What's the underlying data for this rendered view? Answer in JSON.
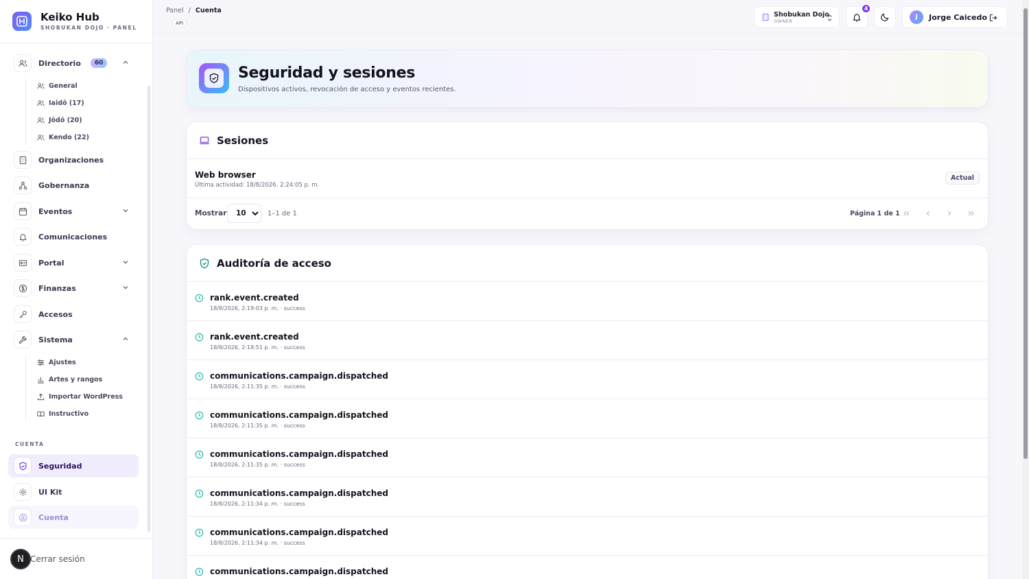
{
  "brand": {
    "title": "Keiko Hub",
    "subtitle": "SHOBUKAN DOJO · PANEL"
  },
  "sidebar": {
    "directorio": {
      "label": "Directorio",
      "badge": "60"
    },
    "directorio_items": [
      "General",
      "Iaidō (17)",
      "Jōdō (20)",
      "Kendo (22)"
    ],
    "items": {
      "organizaciones": "Organizaciones",
      "gobernanza": "Gobernanza",
      "eventos": "Eventos",
      "comunicaciones": "Comunicaciones",
      "portal": "Portal",
      "finanzas": "Finanzas",
      "accesos": "Accesos",
      "sistema": "Sistema"
    },
    "sistema_items": [
      "Ajustes",
      "Artes y rangos",
      "Importar WordPress",
      "Instructivo"
    ],
    "section_cuenta": "CUENTA",
    "seguridad": "Seguridad",
    "uikit": "UI Kit",
    "cuenta": "Cuenta",
    "logout": "Cerrar sesión",
    "logout_avatar": "N"
  },
  "topbar": {
    "crumb_root": "Panel",
    "crumb_sep": "/",
    "crumb_current": "Cuenta",
    "api_tag": "API",
    "org_name": "Shobukan Dojo",
    "org_role": "OWNER",
    "notif_count": "4",
    "user_initial": "J",
    "user_name": "Jorge Caicedo"
  },
  "hero": {
    "title": "Seguridad y sesiones",
    "subtitle": "Dispositivos activos, revocación de acceso y eventos recientes."
  },
  "sessions": {
    "title": "Sesiones",
    "row": {
      "name": "Web browser",
      "meta": "Última actividad: 18/8/2026, 2:24:05 p. m.",
      "badge": "Actual"
    },
    "show_label": "Mostrar",
    "page_size": "10",
    "range": "1–1 de 1",
    "page": "Página 1 de 1"
  },
  "audit": {
    "title": "Auditoría de acceso",
    "rows": [
      {
        "event": "rank.event.created",
        "meta": "18/8/2026, 2:19:03 p. m. · success"
      },
      {
        "event": "rank.event.created",
        "meta": "18/8/2026, 2:18:51 p. m. · success"
      },
      {
        "event": "communications.campaign.dispatched",
        "meta": "18/8/2026, 2:11:35 p. m. · success"
      },
      {
        "event": "communications.campaign.dispatched",
        "meta": "18/8/2026, 2:11:35 p. m. · success"
      },
      {
        "event": "communications.campaign.dispatched",
        "meta": "18/8/2026, 2:11:35 p. m. · success"
      },
      {
        "event": "communications.campaign.dispatched",
        "meta": "18/8/2026, 2:11:34 p. m. · success"
      },
      {
        "event": "communications.campaign.dispatched",
        "meta": "18/8/2026, 2:11:34 p. m. · success"
      },
      {
        "event": "communications.campaign.dispatched",
        "meta": ""
      }
    ]
  },
  "colors": {
    "accent": "#7c3aed",
    "active_bg": "#f1edfe",
    "clock_teal": "#14b8a6"
  }
}
